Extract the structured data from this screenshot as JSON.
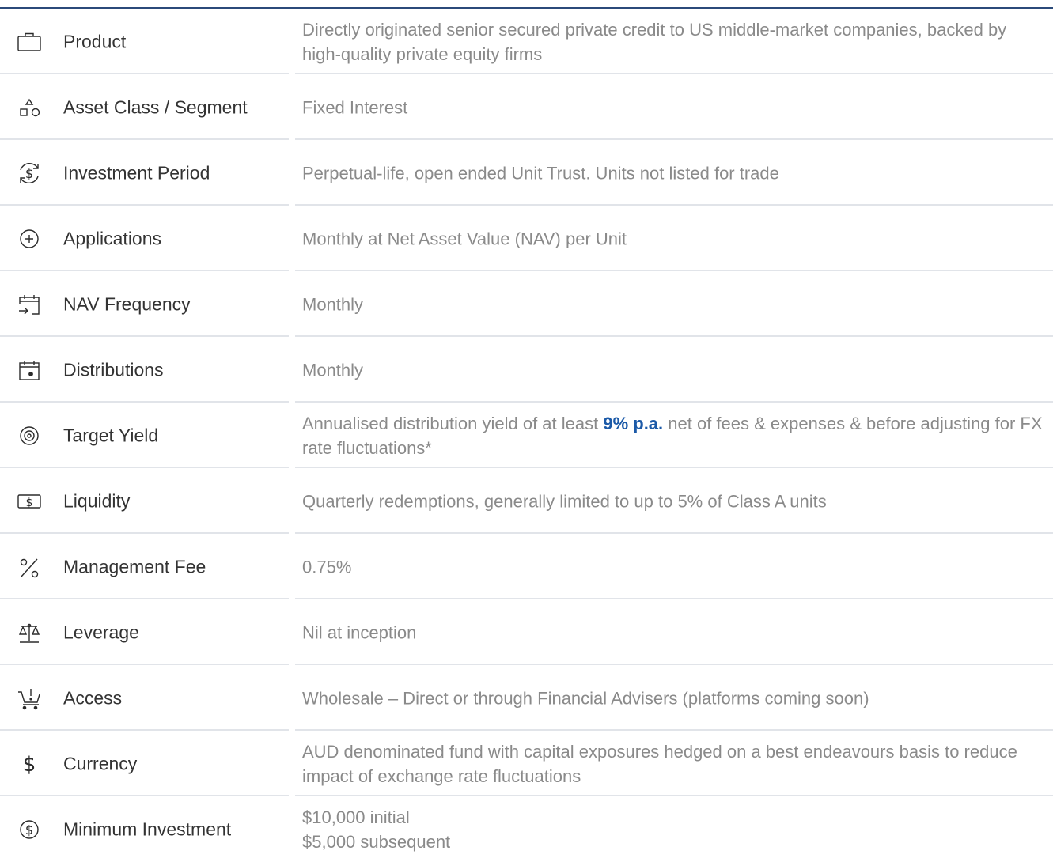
{
  "rows": [
    {
      "icon": "briefcase-icon",
      "label": "Product",
      "value": "Directly originated senior secured private credit to US middle-market companies, backed by high-quality private equity firms"
    },
    {
      "icon": "shapes-icon",
      "label": "Asset Class / Segment",
      "value": "Fixed Interest"
    },
    {
      "icon": "dollar-cycle-icon",
      "label": "Investment Period",
      "value": "Perpetual-life, open ended Unit Trust. Units not listed for trade"
    },
    {
      "icon": "plus-circle-icon",
      "label": "Applications",
      "value": "Monthly at Net Asset Value (NAV) per Unit"
    },
    {
      "icon": "calendar-arrow-icon",
      "label": "NAV Frequency",
      "value": "Monthly"
    },
    {
      "icon": "calendar-dot-icon",
      "label": "Distributions",
      "value": "Monthly"
    },
    {
      "icon": "target-icon",
      "label": "Target Yield",
      "value_before": "Annualised distribution yield of at least ",
      "value_highlight": "9% p.a.",
      "value_after": " net of fees & expenses & before adjusting for FX rate fluctuations*"
    },
    {
      "icon": "cash-note-icon",
      "label": "Liquidity",
      "value": "Quarterly redemptions, generally limited to up to 5% of Class A units"
    },
    {
      "icon": "percent-icon",
      "label": "Management Fee",
      "value": "0.75%"
    },
    {
      "icon": "scales-icon",
      "label": "Leverage",
      "value": "Nil at inception"
    },
    {
      "icon": "cart-alert-icon",
      "label": "Access",
      "value": "Wholesale – Direct or through Financial Advisers (platforms coming soon)"
    },
    {
      "icon": "dollar-icon",
      "label": "Currency",
      "value": "AUD denominated fund with capital exposures hedged on a best endeavours basis to reduce impact of exchange rate fluctuations"
    },
    {
      "icon": "dollar-circle-icon",
      "label": "Minimum Investment",
      "value_line1": "$10,000 initial",
      "value_line2": "$5,000 subsequent"
    }
  ],
  "colors": {
    "highlight": "#1c5aa8",
    "label": "#333333",
    "value": "#8a8a8a",
    "rule": "#2b4a7a"
  }
}
